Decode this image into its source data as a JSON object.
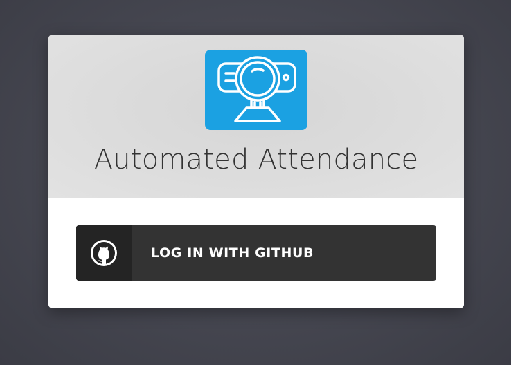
{
  "app": {
    "title": "Automated Attendance",
    "logo_icon": "webcam-icon",
    "logo_color": "#1ba1e2"
  },
  "login": {
    "github_button_label": "LOG IN WITH GITHUB",
    "github_icon": "github-icon",
    "button_color": "#333333"
  }
}
